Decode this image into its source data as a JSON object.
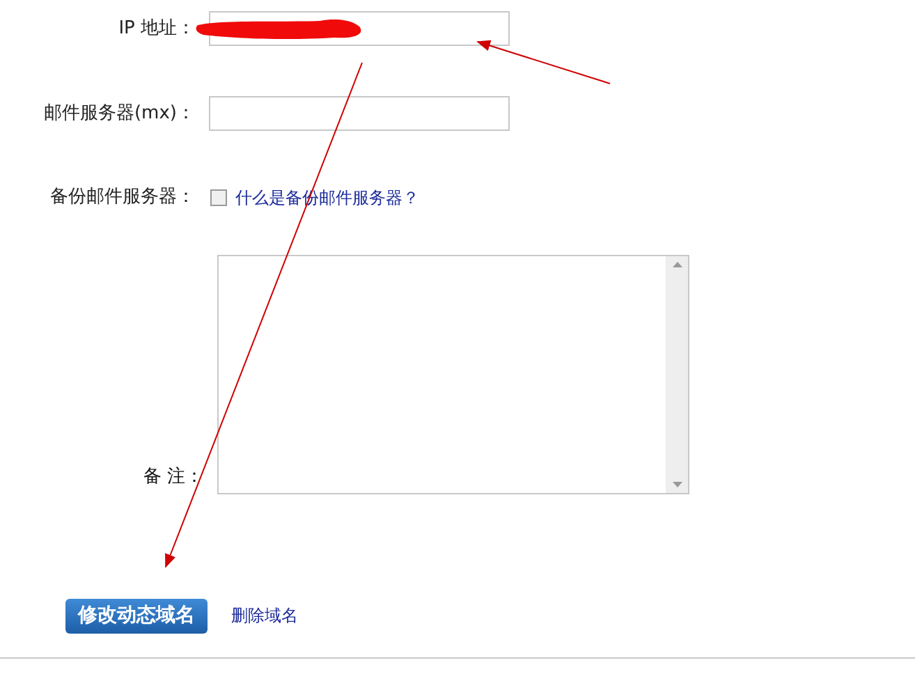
{
  "fields": [
    {
      "label": "IP 地址：",
      "redacted": true
    },
    {
      "label": "邮件服务器(mx)：",
      "redacted": false
    }
  ],
  "backup": {
    "label": "备份邮件服务器：",
    "checked": false,
    "help_link": "什么是备份邮件服务器？"
  },
  "notes": {
    "label": "备 注："
  },
  "actions": {
    "submit": "修改动态域名",
    "delete_link": "删除域名"
  }
}
